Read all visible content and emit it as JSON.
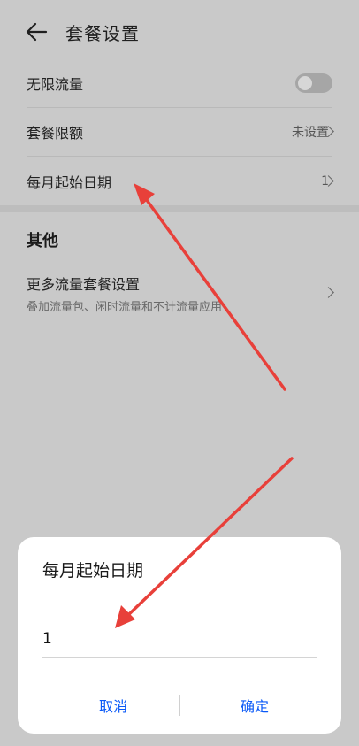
{
  "header": {
    "title": "套餐设置",
    "back_icon": "arrow-left-icon"
  },
  "settings": {
    "unlimited": {
      "label": "无限流量",
      "enabled": false
    },
    "limit": {
      "label": "套餐限额",
      "value": "未设置"
    },
    "start_date": {
      "label": "每月起始日期",
      "value": "1"
    }
  },
  "other": {
    "title": "其他",
    "more": {
      "title": "更多流量套餐设置",
      "subtitle": "叠加流量包、闲时流量和不计流量应用"
    }
  },
  "dialog": {
    "title": "每月起始日期",
    "input_value": "1",
    "cancel_label": "取消",
    "ok_label": "确定"
  },
  "colors": {
    "accent": "#0a59f7",
    "annotation": "#e8403a"
  }
}
